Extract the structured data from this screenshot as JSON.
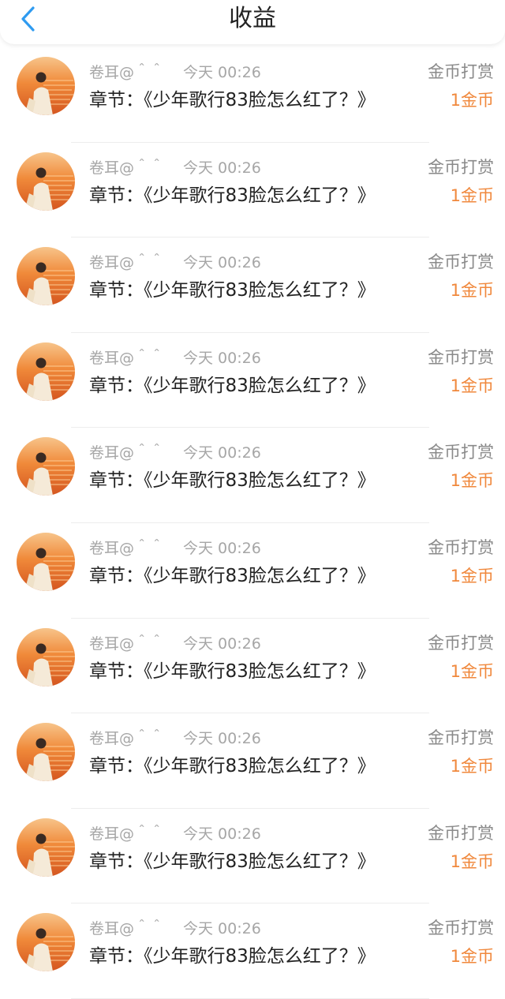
{
  "header": {
    "title": "收益",
    "back_icon": "chevron-left-icon",
    "accent_color": "#2f9bf0"
  },
  "colors": {
    "amount": "#f0883c",
    "meta": "#a6a6a6",
    "text": "#222222"
  },
  "items": [
    {
      "user": "卷耳@＾＾",
      "time": "今天 00:26",
      "chapter": "章节：《少年歌行83脸怎么红了？》",
      "reward_type": "金币打赏",
      "amount": "1金币"
    },
    {
      "user": "卷耳@＾＾",
      "time": "今天 00:26",
      "chapter": "章节：《少年歌行83脸怎么红了？》",
      "reward_type": "金币打赏",
      "amount": "1金币"
    },
    {
      "user": "卷耳@＾＾",
      "time": "今天 00:26",
      "chapter": "章节：《少年歌行83脸怎么红了？》",
      "reward_type": "金币打赏",
      "amount": "1金币"
    },
    {
      "user": "卷耳@＾＾",
      "time": "今天 00:26",
      "chapter": "章节：《少年歌行83脸怎么红了？》",
      "reward_type": "金币打赏",
      "amount": "1金币"
    },
    {
      "user": "卷耳@＾＾",
      "time": "今天 00:26",
      "chapter": "章节：《少年歌行83脸怎么红了？》",
      "reward_type": "金币打赏",
      "amount": "1金币"
    },
    {
      "user": "卷耳@＾＾",
      "time": "今天 00:26",
      "chapter": "章节：《少年歌行83脸怎么红了？》",
      "reward_type": "金币打赏",
      "amount": "1金币"
    },
    {
      "user": "卷耳@＾＾",
      "time": "今天 00:26",
      "chapter": "章节：《少年歌行83脸怎么红了？》",
      "reward_type": "金币打赏",
      "amount": "1金币"
    },
    {
      "user": "卷耳@＾＾",
      "time": "今天 00:26",
      "chapter": "章节：《少年歌行83脸怎么红了？》",
      "reward_type": "金币打赏",
      "amount": "1金币"
    },
    {
      "user": "卷耳@＾＾",
      "time": "今天 00:26",
      "chapter": "章节：《少年歌行83脸怎么红了？》",
      "reward_type": "金币打赏",
      "amount": "1金币"
    },
    {
      "user": "卷耳@＾＾",
      "time": "今天 00:26",
      "chapter": "章节：《少年歌行83脸怎么红了？》",
      "reward_type": "金币打赏",
      "amount": "1金币"
    }
  ]
}
